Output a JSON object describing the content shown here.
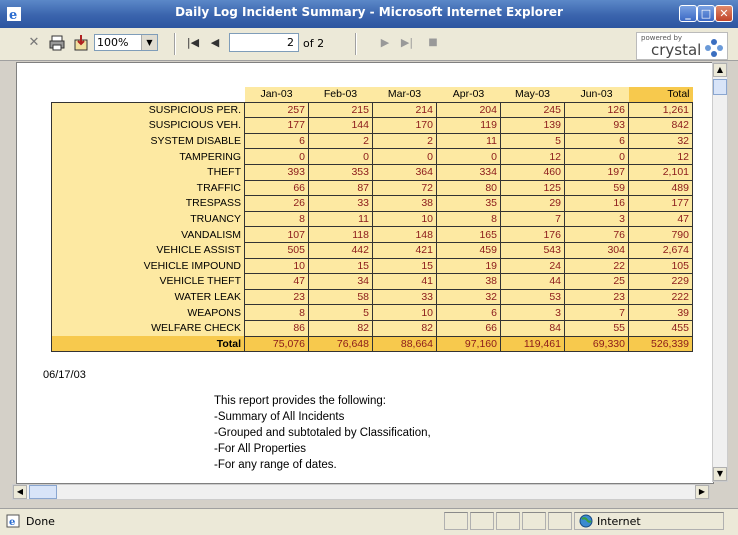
{
  "window": {
    "title": "Daily Log Incident Summary - Microsoft Internet Explorer",
    "minimize": "_",
    "maximize": "□",
    "close": "✕"
  },
  "toolbar": {
    "zoom": "100%",
    "page_current": "2",
    "page_total": "of 2",
    "brand_powered": "powered by",
    "brand_name": "crystal"
  },
  "report": {
    "columns": [
      "Jan-03",
      "Feb-03",
      "Mar-03",
      "Apr-03",
      "May-03",
      "Jun-03",
      "Total"
    ],
    "rows": [
      {
        "label": "SUSPICIOUS PER.",
        "values": [
          "257",
          "215",
          "214",
          "204",
          "245",
          "126",
          "1,261"
        ]
      },
      {
        "label": "SUSPICIOUS VEH.",
        "values": [
          "177",
          "144",
          "170",
          "119",
          "139",
          "93",
          "842"
        ]
      },
      {
        "label": "SYSTEM DISABLE",
        "values": [
          "6",
          "2",
          "2",
          "11",
          "5",
          "6",
          "32"
        ]
      },
      {
        "label": "TAMPERING",
        "values": [
          "0",
          "0",
          "0",
          "0",
          "12",
          "0",
          "12"
        ]
      },
      {
        "label": "THEFT",
        "values": [
          "393",
          "353",
          "364",
          "334",
          "460",
          "197",
          "2,101"
        ]
      },
      {
        "label": "TRAFFIC",
        "values": [
          "66",
          "87",
          "72",
          "80",
          "125",
          "59",
          "489"
        ]
      },
      {
        "label": "TRESPASS",
        "values": [
          "26",
          "33",
          "38",
          "35",
          "29",
          "16",
          "177"
        ]
      },
      {
        "label": "TRUANCY",
        "values": [
          "8",
          "11",
          "10",
          "8",
          "7",
          "3",
          "47"
        ]
      },
      {
        "label": "VANDALISM",
        "values": [
          "107",
          "118",
          "148",
          "165",
          "176",
          "76",
          "790"
        ]
      },
      {
        "label": "VEHICLE ASSIST",
        "values": [
          "505",
          "442",
          "421",
          "459",
          "543",
          "304",
          "2,674"
        ]
      },
      {
        "label": "VEHICLE IMPOUND",
        "values": [
          "10",
          "15",
          "15",
          "19",
          "24",
          "22",
          "105"
        ]
      },
      {
        "label": "VEHICLE THEFT",
        "values": [
          "47",
          "34",
          "41",
          "38",
          "44",
          "25",
          "229"
        ]
      },
      {
        "label": "WATER LEAK",
        "values": [
          "23",
          "58",
          "33",
          "32",
          "53",
          "23",
          "222"
        ]
      },
      {
        "label": "WEAPONS",
        "values": [
          "8",
          "5",
          "10",
          "6",
          "3",
          "7",
          "39"
        ]
      },
      {
        "label": "WELFARE CHECK",
        "values": [
          "86",
          "82",
          "82",
          "66",
          "84",
          "55",
          "455"
        ]
      }
    ],
    "total_row": {
      "label": "Total",
      "values": [
        "75,076",
        "76,648",
        "88,664",
        "97,160",
        "119,461",
        "69,330",
        "526,339"
      ]
    },
    "date": "06/17/03",
    "description": [
      "This report provides the following:",
      "-Summary of All Incidents",
      "-Grouped and subtotaled by Classification,",
      "-For All Properties",
      "-For any range of dates."
    ]
  },
  "status": {
    "text": "Done",
    "zone": "Internet"
  }
}
